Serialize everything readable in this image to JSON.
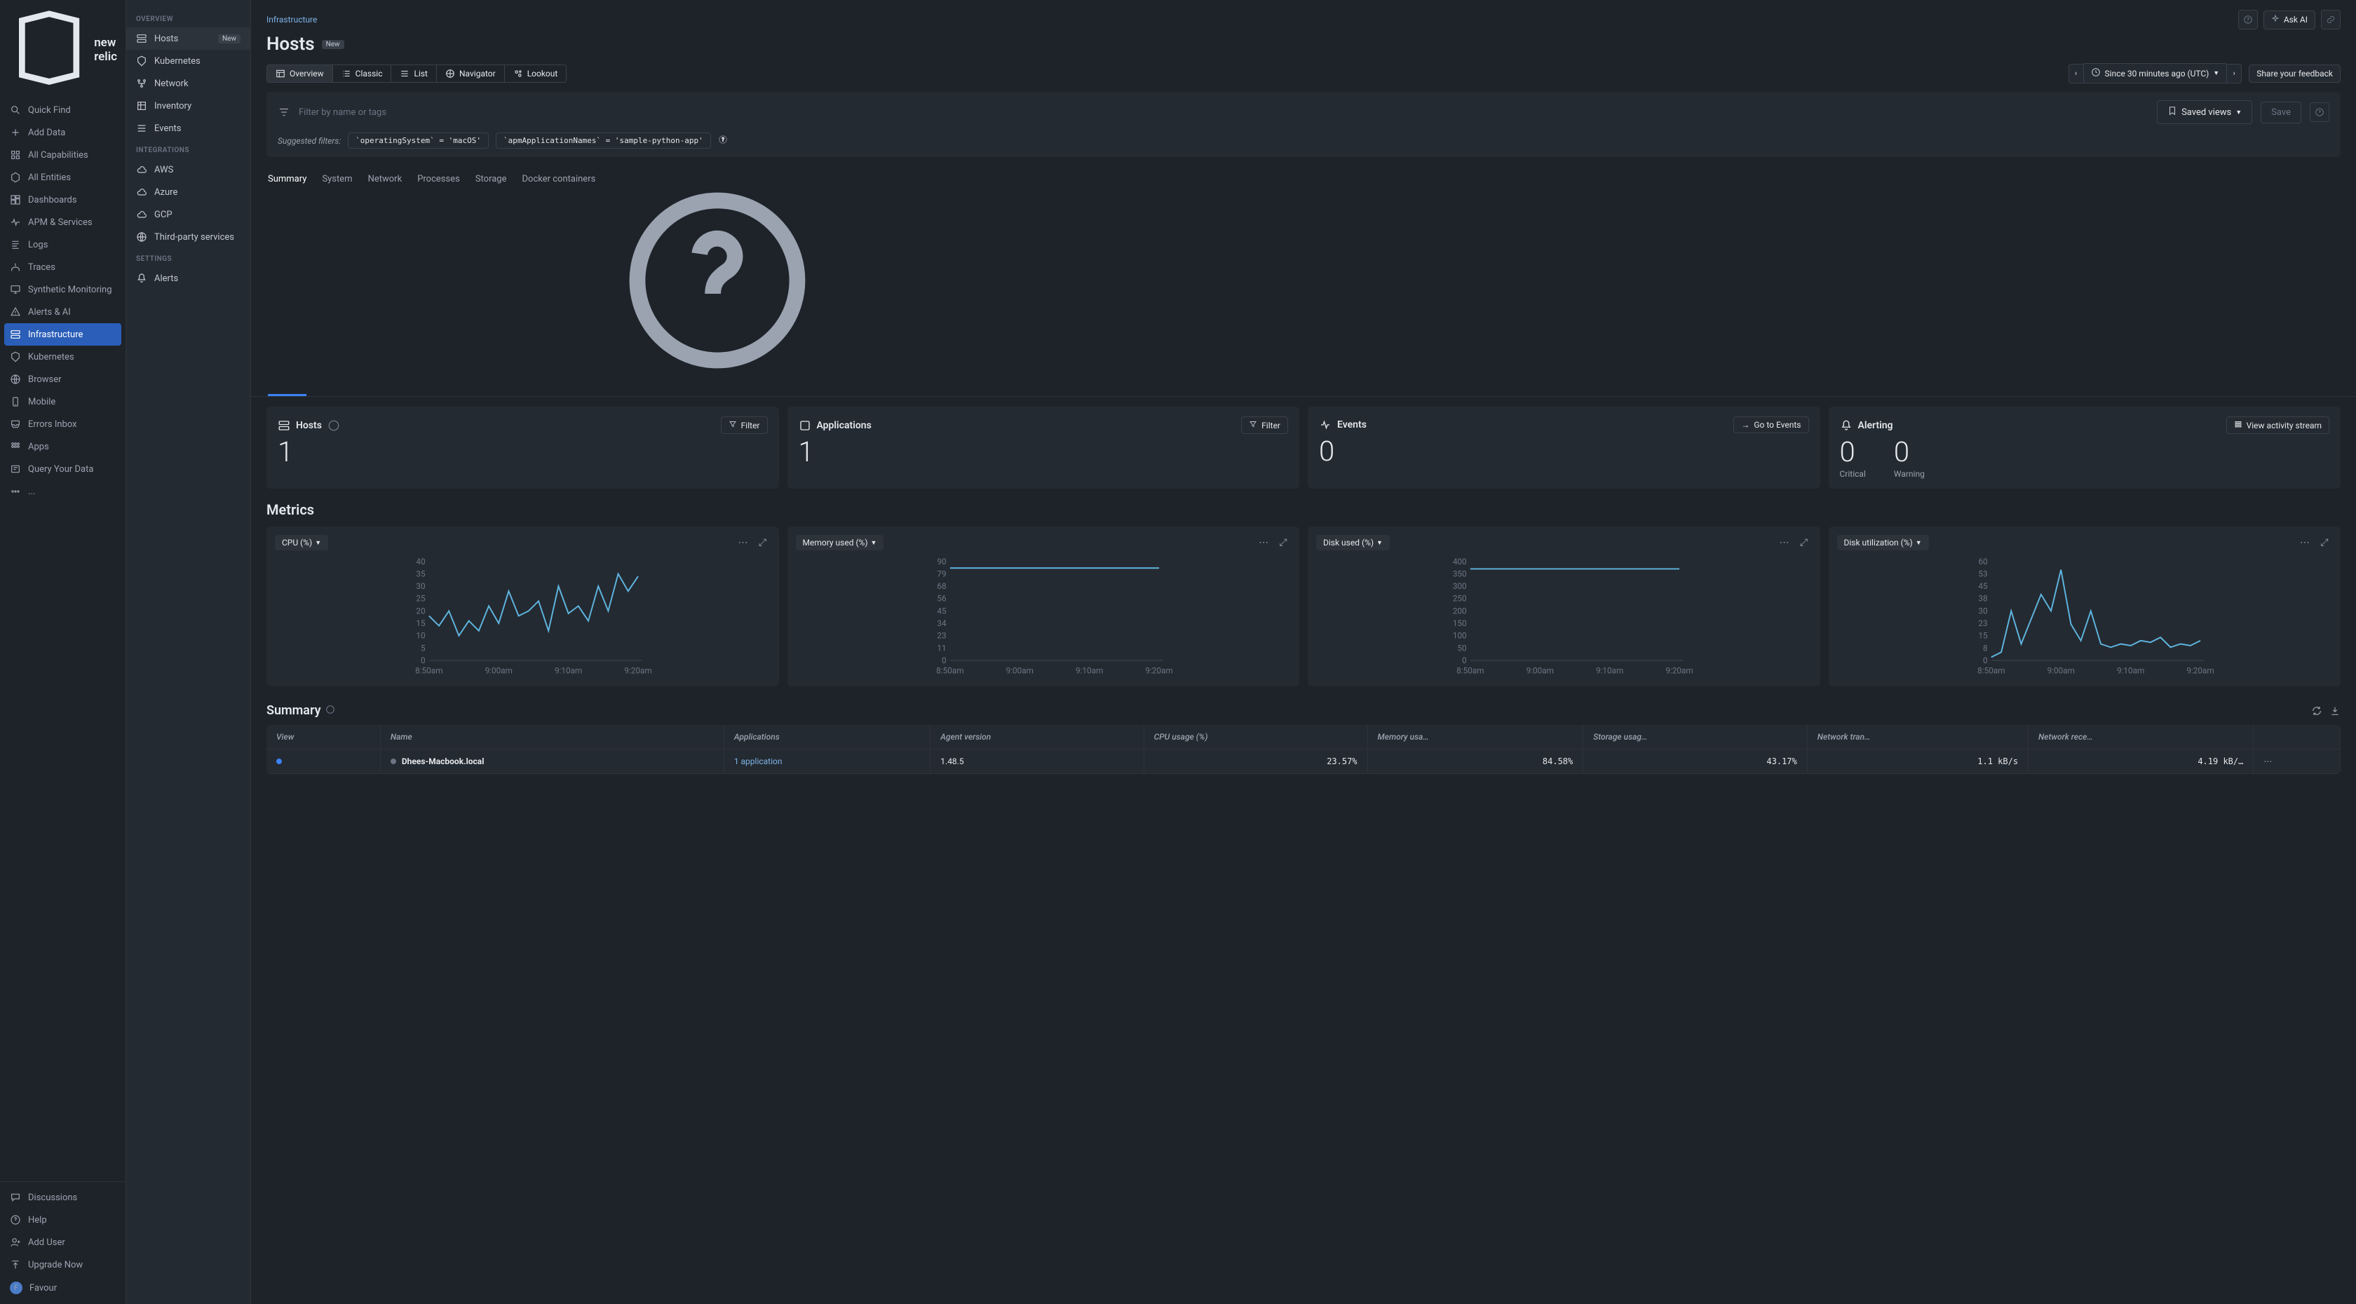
{
  "brand": "new relic",
  "leftnav": [
    {
      "icon": "search",
      "label": "Quick Find"
    },
    {
      "icon": "plus",
      "label": "Add Data"
    },
    {
      "icon": "grid",
      "label": "All Capabilities"
    },
    {
      "icon": "hex",
      "label": "All Entities"
    },
    {
      "icon": "dash",
      "label": "Dashboards"
    },
    {
      "icon": "pulse",
      "label": "APM & Services"
    },
    {
      "icon": "logs",
      "label": "Logs"
    },
    {
      "icon": "trace",
      "label": "Traces"
    },
    {
      "icon": "monitor",
      "label": "Synthetic Monitoring"
    },
    {
      "icon": "alert",
      "label": "Alerts & AI"
    },
    {
      "icon": "server",
      "label": "Infrastructure",
      "active": true
    },
    {
      "icon": "k8s",
      "label": "Kubernetes"
    },
    {
      "icon": "globe",
      "label": "Browser"
    },
    {
      "icon": "mobile",
      "label": "Mobile"
    },
    {
      "icon": "inbox",
      "label": "Errors Inbox"
    },
    {
      "icon": "apps",
      "label": "Apps"
    },
    {
      "icon": "query",
      "label": "Query Your Data"
    },
    {
      "icon": "dots",
      "label": "..."
    }
  ],
  "leftnav_bottom": [
    {
      "icon": "chat",
      "label": "Discussions"
    },
    {
      "icon": "help",
      "label": "Help"
    },
    {
      "icon": "adduser",
      "label": "Add User"
    },
    {
      "icon": "upgrade",
      "label": "Upgrade Now"
    },
    {
      "icon": "avatar",
      "label": "Favour"
    }
  ],
  "subnav": {
    "sections": [
      {
        "title": "OVERVIEW",
        "items": [
          {
            "icon": "server",
            "label": "Hosts",
            "badge": "New",
            "active": true
          },
          {
            "icon": "k8s",
            "label": "Kubernetes"
          },
          {
            "icon": "net",
            "label": "Network"
          },
          {
            "icon": "inv",
            "label": "Inventory"
          },
          {
            "icon": "events",
            "label": "Events"
          }
        ]
      },
      {
        "title": "INTEGRATIONS",
        "items": [
          {
            "icon": "cloud",
            "label": "AWS"
          },
          {
            "icon": "cloud",
            "label": "Azure"
          },
          {
            "icon": "cloud",
            "label": "GCP"
          },
          {
            "icon": "globe",
            "label": "Third-party services"
          }
        ]
      },
      {
        "title": "SETTINGS",
        "items": [
          {
            "icon": "bell",
            "label": "Alerts"
          }
        ]
      }
    ]
  },
  "breadcrumb": "Infrastructure",
  "page": {
    "title": "Hosts",
    "badge": "New"
  },
  "top_right": {
    "ask_ai": "Ask AI",
    "feedback": "Share your feedback"
  },
  "view_tabs": [
    {
      "icon": "layout",
      "label": "Overview",
      "active": true
    },
    {
      "icon": "list",
      "label": "Classic"
    },
    {
      "icon": "list2",
      "label": "List"
    },
    {
      "icon": "nav",
      "label": "Navigator"
    },
    {
      "icon": "lookout",
      "label": "Lookout"
    }
  ],
  "timepicker": "Since 30 minutes ago (UTC)",
  "filter": {
    "placeholder": "Filter by name or tags",
    "saved_views": "Saved views",
    "save": "Save",
    "suggest_label": "Suggested filters:",
    "chips": [
      "`operatingSystem` = 'macOS'",
      "`apmApplicationNames` = 'sample-python-app'"
    ]
  },
  "tabs": [
    {
      "label": "Summary",
      "active": true
    },
    {
      "label": "System"
    },
    {
      "label": "Network"
    },
    {
      "label": "Processes"
    },
    {
      "label": "Storage"
    },
    {
      "label": "Docker containers"
    }
  ],
  "kpis": {
    "hosts": {
      "title": "Hosts",
      "value": "1",
      "action": "Filter"
    },
    "apps": {
      "title": "Applications",
      "value": "1",
      "action": "Filter"
    },
    "events": {
      "title": "Events",
      "value": "0",
      "action": "Go to Events"
    },
    "alerting": {
      "title": "Alerting",
      "critical_val": "0",
      "critical_lbl": "Critical",
      "warning_val": "0",
      "warning_lbl": "Warning",
      "action": "View activity stream"
    }
  },
  "metrics_title": "Metrics",
  "charts": [
    {
      "label": "CPU (%)"
    },
    {
      "label": "Memory used (%)"
    },
    {
      "label": "Disk used (%)"
    },
    {
      "label": "Disk utilization (%)"
    }
  ],
  "chart_data": [
    {
      "type": "line",
      "title": "CPU (%)",
      "ylim": [
        0,
        40
      ],
      "x_labels": [
        "8:50am",
        "9:00am",
        "9:10am",
        "9:20am"
      ],
      "values": [
        18,
        14,
        20,
        10,
        16,
        12,
        22,
        15,
        28,
        18,
        20,
        24,
        12,
        30,
        19,
        22,
        16,
        30,
        20,
        35,
        28,
        34
      ]
    },
    {
      "type": "line",
      "title": "Memory used (%)",
      "ylim": [
        0,
        90
      ],
      "x_labels": [
        "8:50am",
        "9:00am",
        "9:10am",
        "9:20am"
      ],
      "values": [
        84,
        84,
        84,
        84,
        84,
        84,
        84,
        84,
        84,
        84,
        84,
        84,
        84,
        84,
        84,
        84,
        84,
        84,
        84,
        84,
        84,
        84
      ]
    },
    {
      "type": "line",
      "title": "Disk used (%)",
      "ylim": [
        0,
        400
      ],
      "x_labels": [
        "8:50am",
        "9:00am",
        "9:10am",
        "9:20am"
      ],
      "values": [
        370,
        370,
        370,
        370,
        370,
        370,
        370,
        370,
        370,
        370,
        370,
        370,
        370,
        370,
        370,
        370,
        370,
        370,
        370,
        370,
        370,
        370
      ]
    },
    {
      "type": "line",
      "title": "Disk utilization (%)",
      "ylim": [
        0,
        60
      ],
      "x_labels": [
        "8:50am",
        "9:00am",
        "9:10am",
        "9:20am"
      ],
      "values": [
        2,
        5,
        30,
        10,
        25,
        40,
        30,
        55,
        22,
        12,
        30,
        10,
        8,
        10,
        9,
        12,
        11,
        14,
        8,
        10,
        9,
        12
      ]
    }
  ],
  "summary": {
    "title": "Summary",
    "columns": [
      "View",
      "Name",
      "Applications",
      "Agent version",
      "CPU usage (%)",
      "Memory usa…",
      "Storage usag…",
      "Network tran…",
      "Network rece…",
      ""
    ],
    "row": {
      "name": "Dhees-Macbook.local",
      "apps": "1 application",
      "agent": "1.48.5",
      "cpu": "23.57%",
      "mem": "84.58%",
      "storage": "43.17%",
      "net_tx": "1.1 kB/s",
      "net_rx": "4.19 kB/…"
    }
  }
}
